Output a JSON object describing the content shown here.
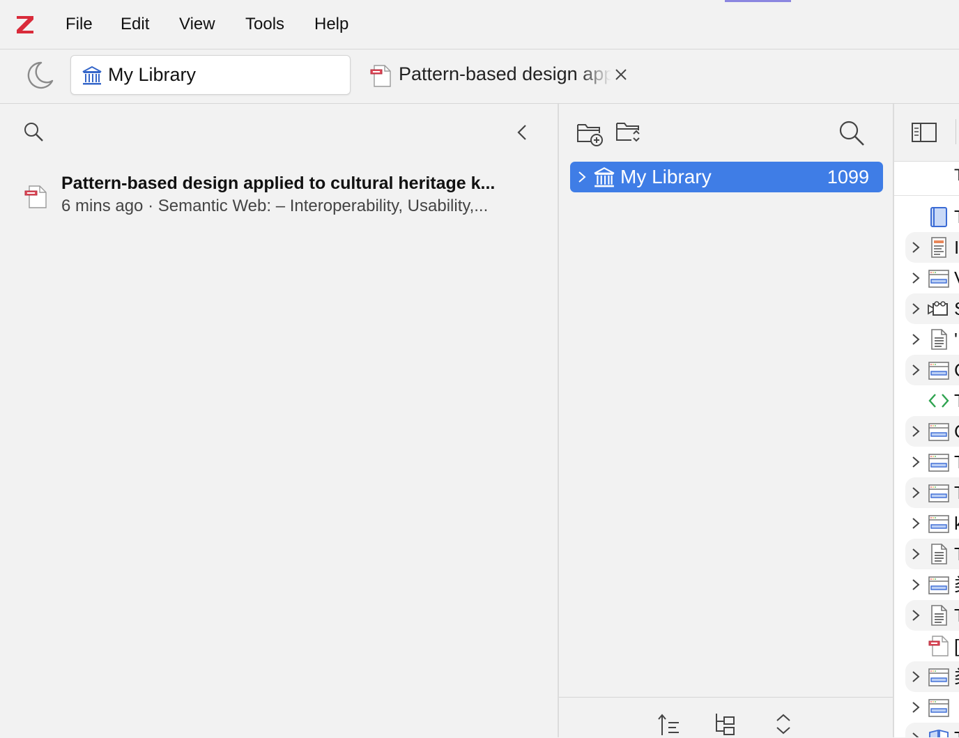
{
  "menubar": {
    "logo": "Z",
    "items": [
      "File",
      "Edit",
      "View",
      "Tools",
      "Help"
    ]
  },
  "tabs": {
    "library_tab": "My Library",
    "document_tab": "Pattern-based design applied to cultural heritage knowledge graphs"
  },
  "recent": {
    "title": "Pattern-based design applied to cultural heritage k...",
    "subtitle": "6 mins ago · Semantic Web: – Interoperability, Usability,..."
  },
  "collections": {
    "library": {
      "label": "My Library",
      "count": "1099"
    }
  },
  "items_pane": {
    "header": "T",
    "rows": [
      {
        "type": "book",
        "expandable": false,
        "alt": false,
        "char": "T"
      },
      {
        "type": "report",
        "expandable": true,
        "alt": true,
        "char": "I"
      },
      {
        "type": "webpage",
        "expandable": true,
        "alt": false,
        "char": "V"
      },
      {
        "type": "video",
        "expandable": true,
        "alt": true,
        "char": "S"
      },
      {
        "type": "document",
        "expandable": true,
        "alt": false,
        "char": "'"
      },
      {
        "type": "webpage",
        "expandable": true,
        "alt": true,
        "char": "C"
      },
      {
        "type": "code",
        "expandable": false,
        "alt": false,
        "char": "T"
      },
      {
        "type": "webpage",
        "expandable": true,
        "alt": true,
        "char": "C"
      },
      {
        "type": "webpage",
        "expandable": true,
        "alt": false,
        "char": "T"
      },
      {
        "type": "webpage",
        "expandable": true,
        "alt": true,
        "char": "T"
      },
      {
        "type": "webpage",
        "expandable": true,
        "alt": false,
        "char": "k"
      },
      {
        "type": "document",
        "expandable": true,
        "alt": true,
        "char": "T"
      },
      {
        "type": "webpage",
        "expandable": true,
        "alt": false,
        "char": "类"
      },
      {
        "type": "document",
        "expandable": true,
        "alt": true,
        "char": "T"
      },
      {
        "type": "pdf",
        "expandable": false,
        "alt": false,
        "char": "["
      },
      {
        "type": "webpage",
        "expandable": true,
        "alt": true,
        "char": "类"
      },
      {
        "type": "webpage",
        "expandable": true,
        "alt": false,
        "char": ""
      },
      {
        "type": "manuscript",
        "expandable": true,
        "alt": true,
        "char": "T"
      }
    ]
  },
  "colors": {
    "accent": "#3f7de6",
    "logo_red": "#d92b3a"
  }
}
